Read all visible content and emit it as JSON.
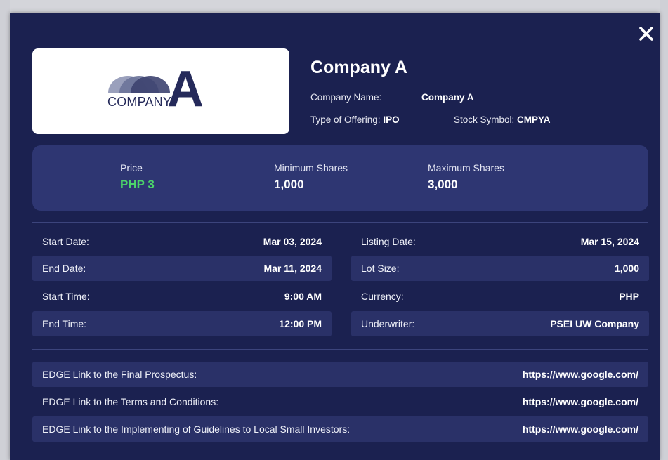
{
  "modal": {
    "close_label": "close",
    "logo": {
      "word": "COMPANY",
      "letter": "A"
    },
    "title": "Company A",
    "company_name_label": "Company Name:",
    "company_name_value": "Company A",
    "offering_label": "Type of Offering:",
    "offering_value": "IPO",
    "symbol_label": "Stock Symbol:",
    "symbol_value": "CMPYA"
  },
  "pricing": {
    "price_label": "Price",
    "price_value": "PHP 3",
    "min_label": "Minimum Shares",
    "min_value": "1,000",
    "max_label": "Maximum Shares",
    "max_value": "3,000"
  },
  "details": {
    "left": [
      {
        "label": "Start Date:",
        "value": "Mar 03, 2024"
      },
      {
        "label": "End Date:",
        "value": "Mar 11, 2024"
      },
      {
        "label": "Start Time:",
        "value": "9:00 AM"
      },
      {
        "label": "End Time:",
        "value": "12:00 PM"
      }
    ],
    "right": [
      {
        "label": "Listing Date:",
        "value": "Mar 15, 2024"
      },
      {
        "label": "Lot Size:",
        "value": "1,000"
      },
      {
        "label": "Currency:",
        "value": "PHP"
      },
      {
        "label": "Underwriter:",
        "value": "PSEI UW Company"
      }
    ]
  },
  "links": [
    {
      "label": "EDGE Link to the Final Prospectus:",
      "url": "https://www.google.com/"
    },
    {
      "label": "EDGE Link to the Terms and Conditions:",
      "url": "https://www.google.com/"
    },
    {
      "label": "EDGE Link to the Implementing of Guidelines to Local Small Investors:",
      "url": "https://www.google.com/"
    }
  ],
  "colors": {
    "modal_bg": "#1b2150",
    "panel_bg": "#2e3672",
    "row_shade": "#2a3168",
    "price_green": "#4cd46a",
    "logo_navy": "#252a5a"
  }
}
